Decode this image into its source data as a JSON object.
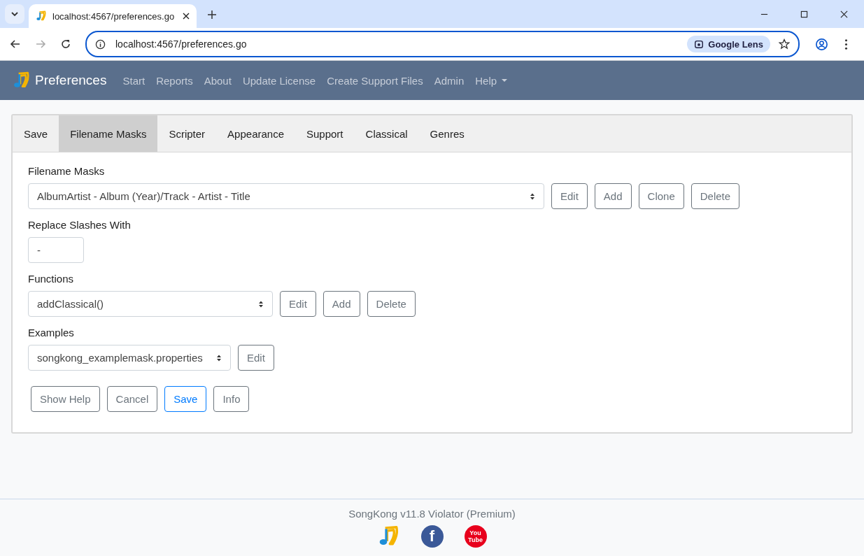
{
  "browser": {
    "tab_title": "localhost:4567/preferences.go",
    "url": "localhost:4567/preferences.go",
    "lens_label": "Google Lens"
  },
  "navbar": {
    "brand": "Preferences",
    "items": [
      {
        "label": "Start",
        "kind": "link"
      },
      {
        "label": "Reports",
        "kind": "link"
      },
      {
        "label": "About",
        "kind": "link"
      },
      {
        "label": "Update License",
        "kind": "link"
      },
      {
        "label": "Create Support Files",
        "kind": "link"
      },
      {
        "label": "Admin",
        "kind": "link"
      },
      {
        "label": "Help",
        "kind": "dropdown"
      }
    ]
  },
  "tabs": [
    {
      "label": "Save",
      "selected": false
    },
    {
      "label": "Filename Masks",
      "selected": true
    },
    {
      "label": "Scripter",
      "selected": false
    },
    {
      "label": "Appearance",
      "selected": false
    },
    {
      "label": "Support",
      "selected": false
    },
    {
      "label": "Classical",
      "selected": false
    },
    {
      "label": "Genres",
      "selected": false
    }
  ],
  "fields": [
    {
      "kind": "select",
      "label": "Filename Masks",
      "value": "AlbumArtist - Album (Year)/Track - Artist - Title",
      "buttons": [
        "Edit",
        "Add",
        "Clone",
        "Delete"
      ]
    },
    {
      "kind": "text",
      "label": "Replace Slashes With",
      "value": "-"
    },
    {
      "kind": "select",
      "label": "Functions",
      "value": "addClassical()",
      "buttons": [
        "Edit",
        "Add",
        "Delete"
      ]
    },
    {
      "kind": "select",
      "label": "Examples",
      "value": "songkong_examplemask.properties",
      "buttons": [
        "Edit"
      ]
    }
  ],
  "actions": [
    {
      "label": "Show Help",
      "kind": "secondary"
    },
    {
      "label": "Cancel",
      "kind": "secondary"
    },
    {
      "label": "Save",
      "kind": "primary"
    },
    {
      "label": "Info",
      "kind": "secondary"
    }
  ],
  "footer": {
    "text": "SongKong v11.8 Violator (Premium)",
    "icons": [
      {
        "kind": "note"
      },
      {
        "kind": "facebook",
        "glyph": "f"
      },
      {
        "kind": "youtube",
        "glyph": "You",
        "glyph2": "Tube"
      }
    ]
  }
}
